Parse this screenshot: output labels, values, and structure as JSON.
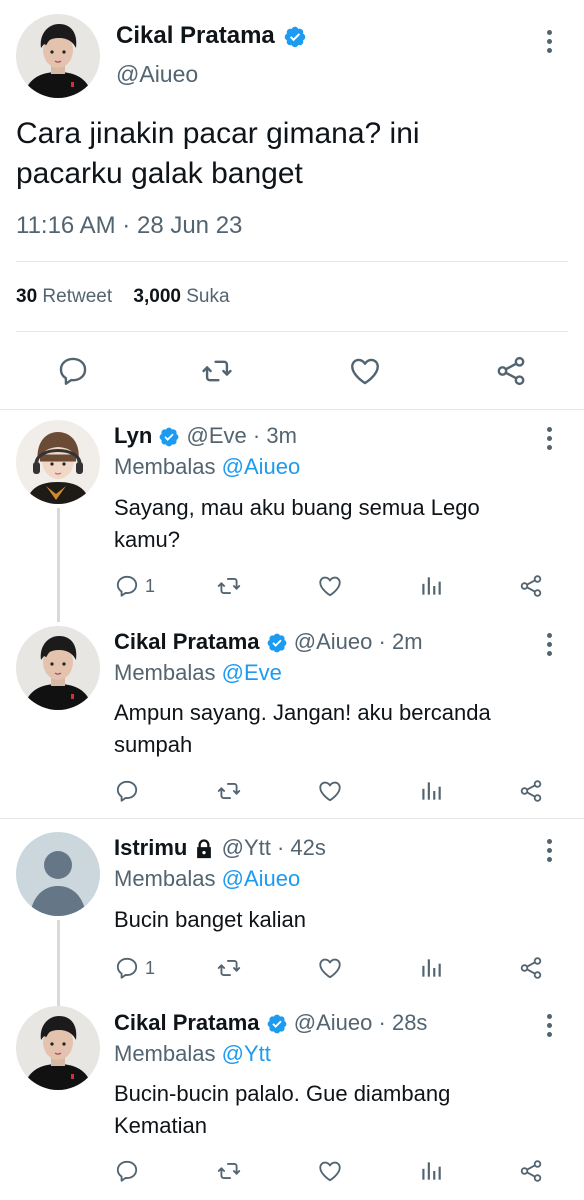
{
  "main_tweet": {
    "display_name": "Cikal Pratama",
    "handle": "@Aiueo",
    "text_line1": "Cara jinakin pacar gimana? ini",
    "text_line2": "pacarku galak banget",
    "time": "11:16 AM",
    "sep": "·",
    "date": "28 Jun 23",
    "retweet_count": "30",
    "retweet_label": "Retweet",
    "like_count": "3,000",
    "like_label": "Suka"
  },
  "replies": [
    {
      "display_name": "Lyn",
      "handle": "@Eve",
      "time": "· 3m",
      "replying_prefix": "Membalas",
      "replying_to": "@Aiueo",
      "text_line1": "Sayang, mau aku buang semua Lego",
      "text_line2": "kamu?",
      "reply_count": "1"
    },
    {
      "display_name": "Cikal Pratama",
      "handle": "@Aiueo",
      "time": "· 2m",
      "replying_prefix": "Membalas",
      "replying_to": "@Eve",
      "text_line1": "Ampun sayang. Jangan! aku bercanda",
      "text_line2": "sumpah",
      "reply_count": ""
    },
    {
      "display_name": "Istrimu",
      "handle": "@Ytt",
      "time": "· 42s",
      "replying_prefix": "Membalas",
      "replying_to": "@Aiueo",
      "text_line1": "Bucin banget kalian",
      "text_line2": "",
      "reply_count": "1"
    },
    {
      "display_name": "Cikal Pratama",
      "handle": "@Aiueo",
      "time": "· 28s",
      "replying_prefix": "Membalas",
      "replying_to": "@Ytt",
      "text_line1": "Bucin-bucin palalo. Gue diambang",
      "text_line2": "Kematian",
      "reply_count": ""
    }
  ],
  "colors": {
    "accent": "#1d9bf0",
    "muted": "#536471",
    "divider": "#e6e6e6"
  },
  "icons": [
    "verified-badge-icon",
    "more-icon",
    "reply-icon",
    "retweet-icon",
    "like-icon",
    "share-icon",
    "analytics-icon",
    "lock-icon"
  ]
}
